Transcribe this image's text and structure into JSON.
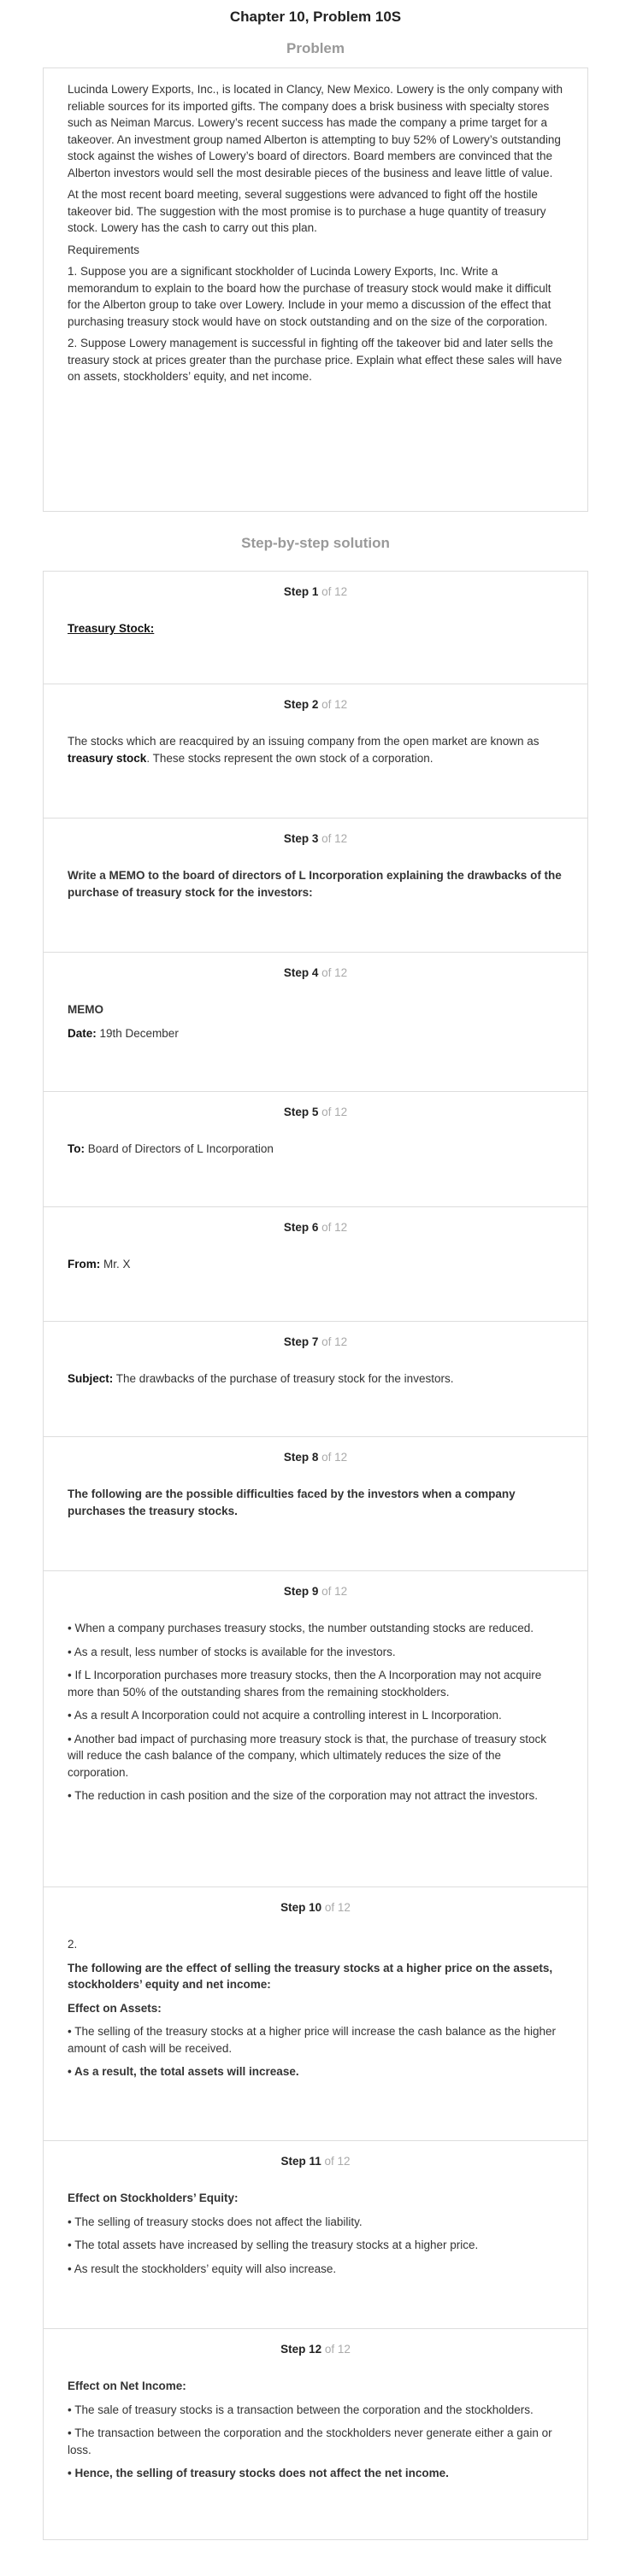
{
  "title": "Chapter 10, Problem 10S",
  "problem": {
    "heading": "Problem",
    "paragraphs": [
      "Lucinda Lowery Exports, Inc., is located in Clancy, New Mexico. Lowery is the only company with reliable sources for its imported gifts. The company does a brisk business with specialty stores such as Neiman Marcus. Lowery’s recent success has made the company a prime target for a takeover. An investment group named Alberton is attempting to buy 52% of Lowery’s outstanding stock against the wishes of Lowery’s board of directors. Board members are convinced that the Alberton investors would sell the most desirable pieces of the business and leave little of value.",
      "At the most recent board meeting, several suggestions were advanced to fight off the hostile takeover bid. The suggestion with the most promise is to purchase a huge quantity of treasury stock. Lowery has the cash to carry out this plan.",
      "Requirements",
      "1. Suppose you are a significant stockholder of Lucinda Lowery Exports, Inc. Write a memorandum to explain to the board how the purchase of treasury stock would make it difficult for the Alberton group to take over Lowery. Include in your memo a discussion of the effect that purchasing treasury stock would have on stock outstanding and on the size of the corporation.",
      "2. Suppose Lowery management is successful in fighting off the takeover bid and later sells the treasury stock at prices greater than the purchase price. Explain what effect these sales will have on assets, stockholders’ equity, and net income."
    ]
  },
  "solution_heading": "Step-by-step solution",
  "step_word": "Step",
  "of_total": "of 12",
  "steps": [
    {
      "num": "1",
      "treasury_stock": "Treasury Stock:"
    },
    {
      "num": "2",
      "pre": "The stocks which are reacquired by an issuing company from the open market are known as ",
      "bold": "treasury stock",
      "post": ". These stocks represent the own stock of a corporation."
    },
    {
      "num": "3",
      "text": "Write a MEMO to the board of directors of L Incorporation explaining the drawbacks of the purchase of treasury stock for the investors:"
    },
    {
      "num": "4",
      "memo": "MEMO",
      "date_label": "Date:",
      "date_value": " 19th December"
    },
    {
      "num": "5",
      "label": "To:",
      "value": " Board of Directors of L Incorporation"
    },
    {
      "num": "6",
      "label": "From:",
      "value": " Mr. X"
    },
    {
      "num": "7",
      "label": "Subject:",
      "value": " The drawbacks of the purchase of treasury stock for the investors."
    },
    {
      "num": "8",
      "text": "The following are the possible difficulties faced by the investors when a company purchases the treasury stocks."
    },
    {
      "num": "9",
      "bullets": [
        "• When a company purchases treasury stocks, the number outstanding stocks are reduced.",
        "• As a result, less number of stocks is available for the investors.",
        "• If L Incorporation purchases more treasury stocks, then the A Incorporation may not acquire more than 50% of the outstanding shares from the remaining stockholders.",
        "• As a result A Incorporation could not acquire a controlling interest in L Incorporation.",
        "• Another bad impact of purchasing more treasury stock is that, the purchase of treasury stock will reduce the cash balance of the company, which ultimately reduces the size of the corporation.",
        "• The reduction in cash position and the size of the corporation may not attract the investors."
      ]
    },
    {
      "num": "10",
      "req": "2.",
      "heading": "The following are the effect of selling the treasury stocks at a higher price on the assets, stockholders’ equity and net income:",
      "sub": "Effect on Assets:",
      "bullet": "• The selling of the treasury stocks at a higher price will increase the cash balance as the higher amount of cash will be received.",
      "conclusion": "• As a result, the total assets will increase."
    },
    {
      "num": "11",
      "sub": "Effect on Stockholders’ Equity:",
      "bullets": [
        "• The selling of treasury stocks does not affect the liability.",
        "• The total assets have increased by selling the treasury stocks at a higher price.",
        "• As result the stockholders’ equity will also increase."
      ]
    },
    {
      "num": "12",
      "sub": "Effect on Net Income:",
      "bullets": [
        "• The sale of treasury stocks is a transaction between the corporation and the stockholders.",
        "• The transaction between the corporation and the stockholders never generate either a gain or loss."
      ],
      "conclusion": "• Hence, the selling of treasury stocks does not affect the net income."
    }
  ]
}
